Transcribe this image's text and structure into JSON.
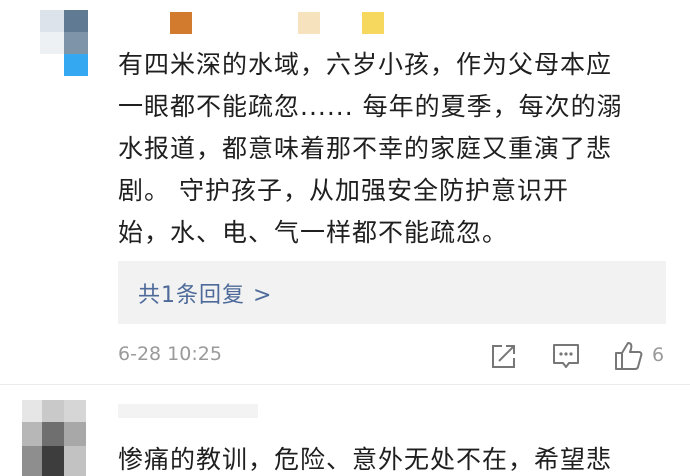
{
  "comment": {
    "text": "有四米深的水域，六岁小孩，作为父母本应一眼都不能疏忽...... 每年的夏季，每次的溺水报道，都意味着那不幸的家庭又重演了悲剧。 守护孩子，从加强安全防护意识开始，水、电、气一样都不能疏忽。",
    "lines": [
      "有四米深的水域，六岁小孩，作为父母本应",
      "一眼都不能疏忽......  每年的夏季，每次的溺",
      "水报道，都意味着那不幸的家庭又重演了悲",
      "剧。  守护孩子，从加强安全防护意识开",
      "始，水、电、气一样都不能疏忽。"
    ],
    "reply_link": "共1条回复 >",
    "timestamp": "6-28 10:25",
    "like_count": "6"
  },
  "comment2": {
    "text": "惨痛的教训，危险、意外无处不在，希望悲"
  },
  "icons": {
    "share": "share-icon",
    "reply": "comment-icon",
    "like": "thumbs-up-icon"
  },
  "colors": {
    "link": "#4e6a9a",
    "meta": "#9a9a9a",
    "reply_bg": "#f2f2f2"
  }
}
